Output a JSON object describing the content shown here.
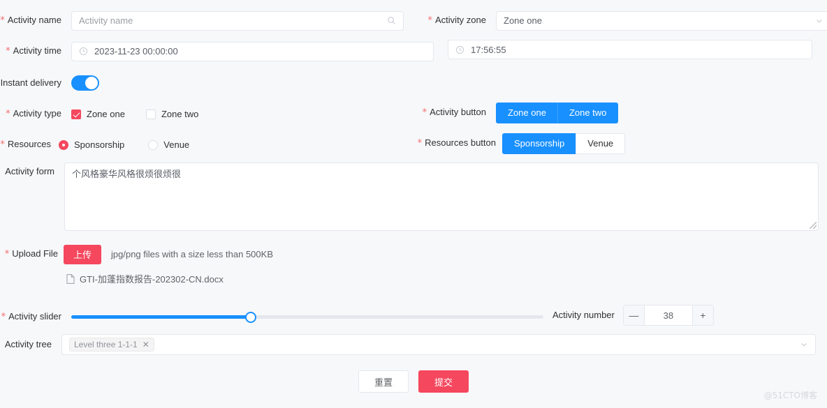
{
  "fields": {
    "activity_name": {
      "label": "Activity name",
      "required": true,
      "placeholder": "Activity name",
      "value": "",
      "icon": "search-icon"
    },
    "activity_zone": {
      "label": "Activity zone",
      "required": true,
      "value": "Zone one",
      "options": [
        "Zone one",
        "Zone two"
      ],
      "icon": "chevron-down-icon"
    },
    "activity_time": {
      "label": "Activity time",
      "required": true,
      "date_value": "2023-11-23 00:00:00",
      "time_value": "17:56:55",
      "icon": "clock-icon"
    },
    "instant_delivery": {
      "label": "Instant delivery",
      "required": false,
      "checked": true
    },
    "activity_type": {
      "label": "Activity type",
      "required": true,
      "options": [
        {
          "label": "Zone one",
          "checked": true
        },
        {
          "label": "Zone two",
          "checked": false
        }
      ]
    },
    "activity_button": {
      "label": "Activity button",
      "required": true,
      "options": [
        {
          "label": "Zone one",
          "selected": true
        },
        {
          "label": "Zone two",
          "selected": true
        }
      ]
    },
    "resources": {
      "label": "Resources",
      "required": true,
      "options": [
        {
          "label": "Sponsorship",
          "checked": true
        },
        {
          "label": "Venue",
          "checked": false
        }
      ]
    },
    "resources_button": {
      "label": "Resources button",
      "required": true,
      "options": [
        {
          "label": "Sponsorship",
          "selected": true
        },
        {
          "label": "Venue",
          "selected": false
        }
      ]
    },
    "activity_form": {
      "label": "Activity form",
      "required": false,
      "value": "个风格豪华风格很烦很烦很"
    },
    "upload_file": {
      "label": "Upload File",
      "required": true,
      "button_label": "上传",
      "hint": "jpg/png files with a size less than 500KB",
      "files": [
        {
          "name": "GTI-加蓬指数报告-202302-CN.docx",
          "icon": "document-icon"
        }
      ]
    },
    "activity_slider": {
      "label": "Activity slider",
      "required": true,
      "value": 38,
      "min": 0,
      "max": 100,
      "percent": 38
    },
    "activity_number": {
      "label": "Activity number",
      "required": false,
      "value": "38",
      "decrement_label": "—",
      "increment_label": "+"
    },
    "activity_tree": {
      "label": "Activity tree",
      "required": false,
      "tags": [
        "Level three 1-1-1"
      ],
      "tag_close_label": "✕",
      "icon": "chevron-down-icon"
    }
  },
  "footer": {
    "reset_label": "重置",
    "submit_label": "提交"
  },
  "watermark": "@51CTO博客",
  "colors": {
    "primary_blue": "#1890ff",
    "accent_red": "#f5475e",
    "required_star": "#f56c6c",
    "page_bg": "#f7f8fa",
    "border": "#e4e7ed"
  }
}
